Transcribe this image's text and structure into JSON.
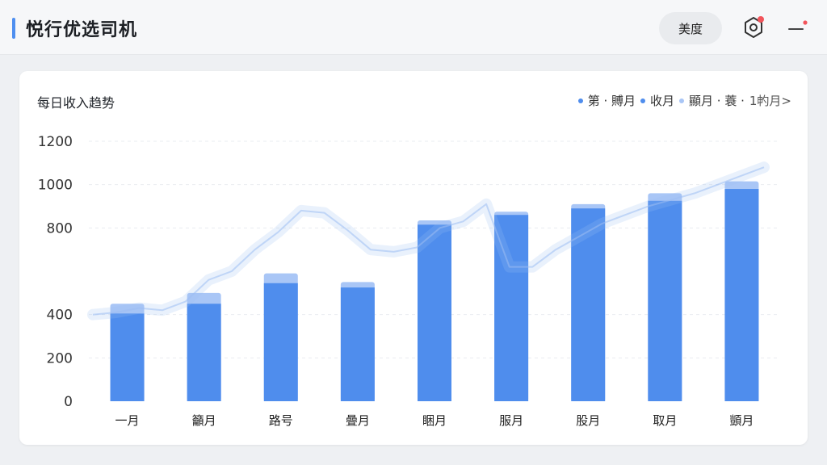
{
  "header": {
    "title": "悦行优选司机",
    "pill_label": "美度"
  },
  "icons": {
    "settings": "hexagon-gear-icon",
    "more": "menu-dash-icon"
  },
  "colors": {
    "accent": "#4e8ff0",
    "bar": "#4f8ded",
    "bar_top": "#a9c6f6",
    "line": "#9dbdf3",
    "badge": "#f2545b"
  },
  "card": {
    "title": "每日收入趋势",
    "legend": [
      {
        "label": "第 · 賻月",
        "color": "#4f8ded"
      },
      {
        "label": "收月",
        "color": "#4f8ded"
      },
      {
        "label": "顯月 · 蓑 ·",
        "color": "#a9c6f6"
      }
    ],
    "legend_more": "1畃月>"
  },
  "chart_data": {
    "type": "bar",
    "categories": [
      "一月",
      "籲月",
      "路号",
      "曡月",
      "睏月",
      "服月",
      "股月",
      "取月",
      "顗月"
    ],
    "series": [
      {
        "values": [
          405,
          450,
          545,
          525,
          815,
          860,
          890,
          925,
          980
        ]
      },
      {
        "values": [
          450,
          500,
          590,
          550,
          835,
          875,
          910,
          960,
          1015
        ]
      }
    ],
    "trend": [
      400,
      410,
      430,
      420,
      460,
      560,
      600,
      700,
      780,
      880,
      870,
      790,
      700,
      690,
      710,
      800,
      830,
      910,
      620,
      620,
      700,
      760,
      820,
      860,
      900,
      930,
      960,
      1000,
      1040,
      1080
    ],
    "yticks": [
      0,
      200,
      400,
      800,
      1000,
      1200
    ],
    "ylim": [
      0,
      1200
    ],
    "grid": true
  }
}
